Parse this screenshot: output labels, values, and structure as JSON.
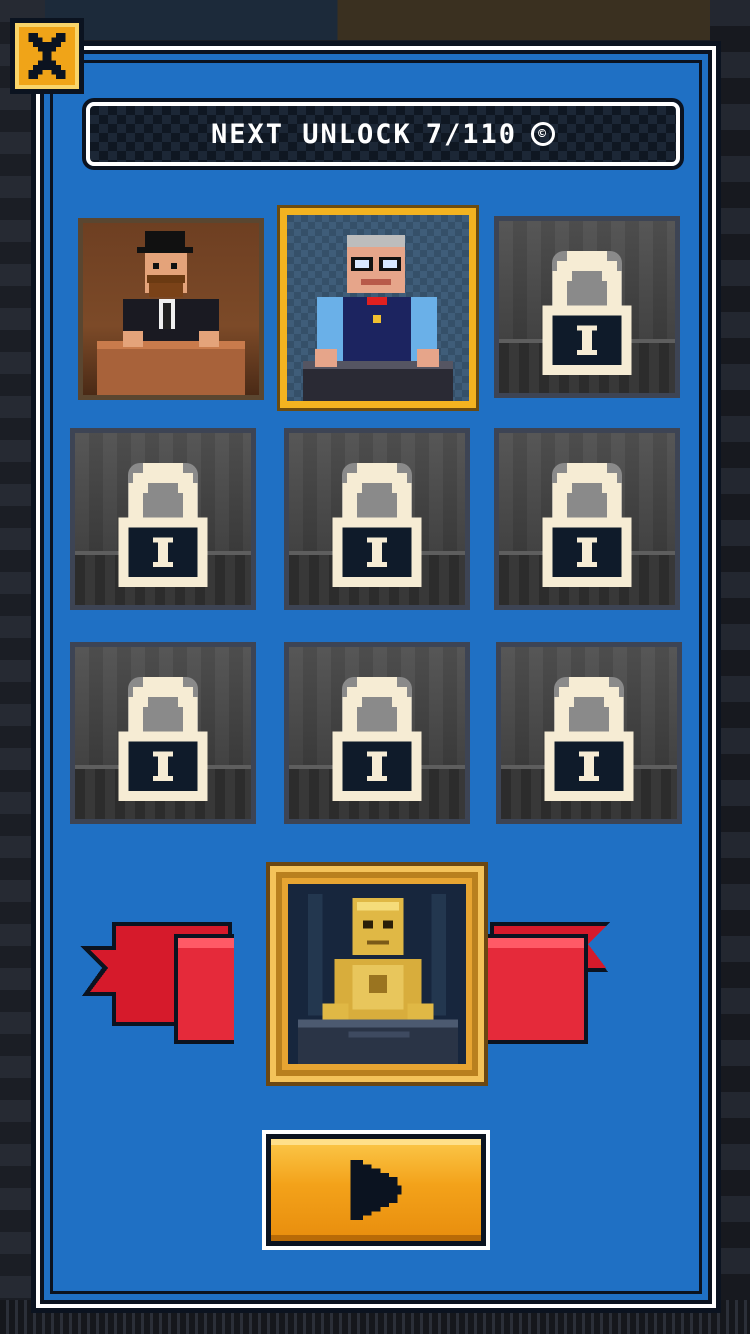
{
  "header": {
    "label": "NEXT UNLOCK",
    "progress": "7/110",
    "currency_icon": "coin-icon"
  },
  "characters": [
    {
      "id": 1,
      "state": "unlocked",
      "selected": false,
      "description": "man-with-bowler-hat"
    },
    {
      "id": 2,
      "state": "unlocked",
      "selected": true,
      "description": "bald-man-with-glasses"
    },
    {
      "id": 3,
      "state": "locked",
      "selected": false
    },
    {
      "id": 4,
      "state": "locked",
      "selected": false
    },
    {
      "id": 5,
      "state": "locked",
      "selected": false
    },
    {
      "id": 6,
      "state": "locked",
      "selected": false
    },
    {
      "id": 7,
      "state": "locked",
      "selected": false
    },
    {
      "id": 8,
      "state": "locked",
      "selected": false
    },
    {
      "id": 9,
      "state": "locked",
      "selected": false
    }
  ],
  "reward": {
    "description": "golden-robot"
  },
  "colors": {
    "panel": "#1f70c4",
    "gold": "#f3b320",
    "ribbon": "#d61a2b",
    "outline": "#0b1320"
  },
  "icons": {
    "close": "close-icon",
    "lock": "lock-icon",
    "play": "play-icon"
  }
}
